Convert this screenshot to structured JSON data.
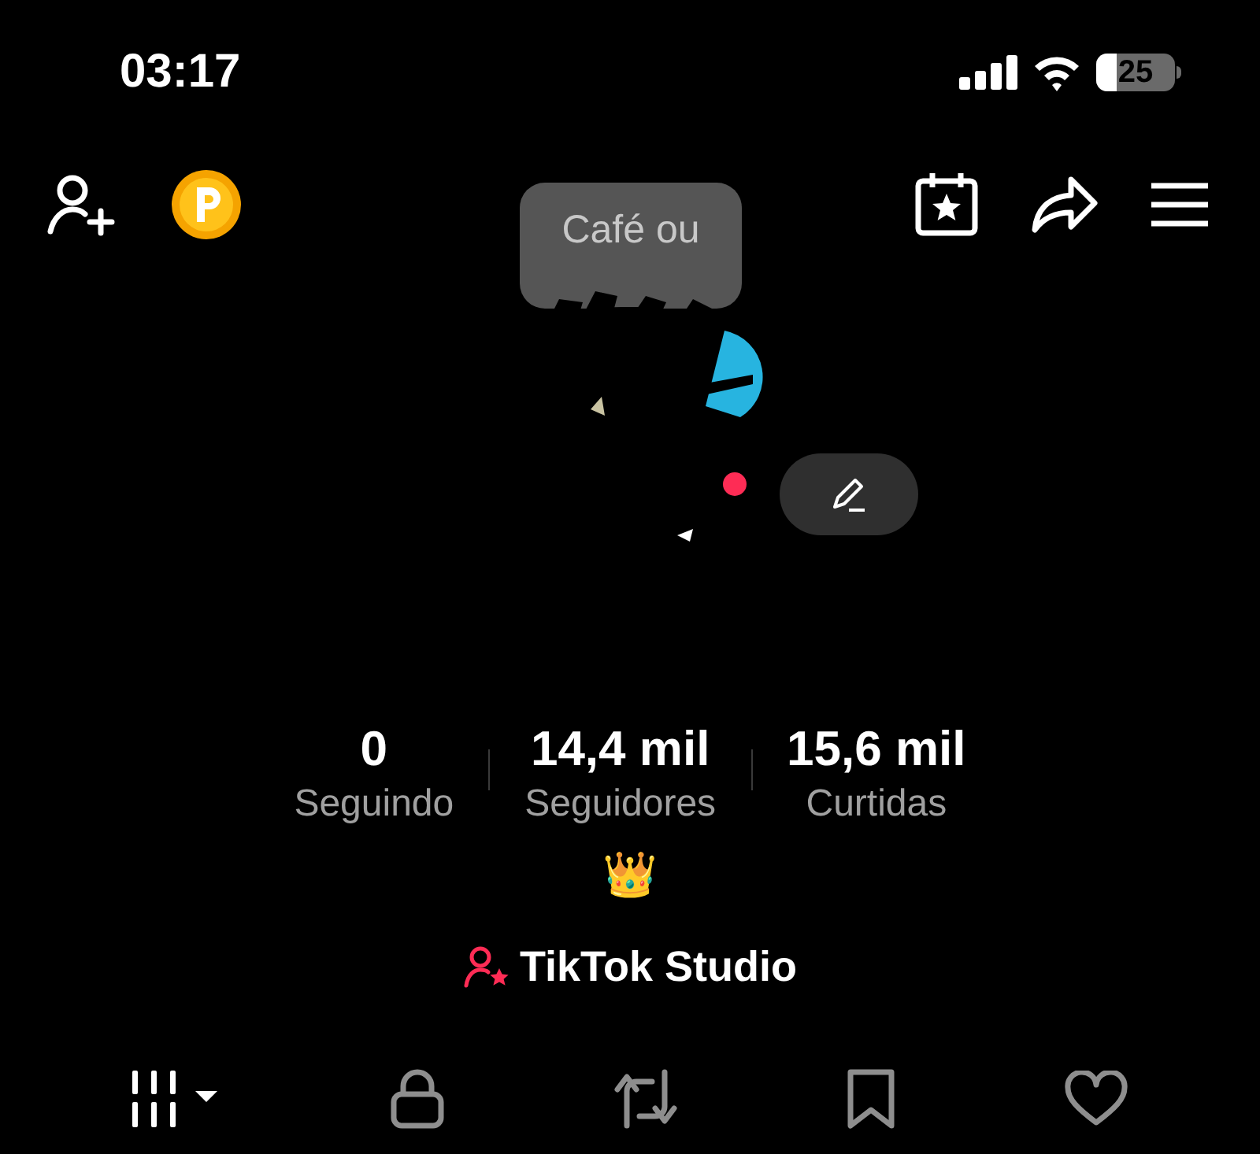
{
  "status_bar": {
    "time": "03:17",
    "battery": "25"
  },
  "note": {
    "text": "Café ou"
  },
  "avatar": {
    "online": true
  },
  "stats": [
    {
      "value": "0",
      "label": "Seguindo"
    },
    {
      "value": "14,4 mil",
      "label": "Seguidores"
    },
    {
      "value": "15,6 mil",
      "label": "Curtidas"
    }
  ],
  "bio": "👑",
  "studio_link": "TikTok Studio",
  "tabs": [
    {
      "kind": "grid",
      "selected": true
    },
    {
      "kind": "lock",
      "selected": false
    },
    {
      "kind": "repost",
      "selected": false
    },
    {
      "kind": "bookmark",
      "selected": false
    },
    {
      "kind": "heart",
      "selected": false
    }
  ]
}
